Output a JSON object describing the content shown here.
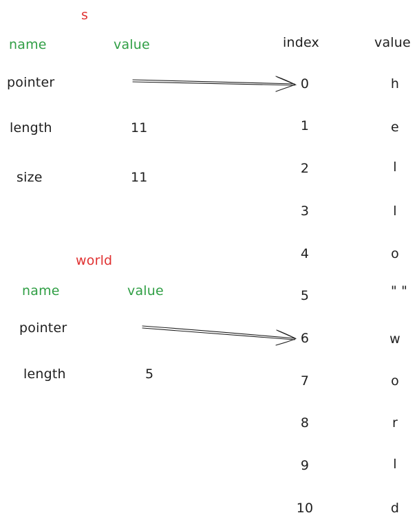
{
  "labels": {
    "struct_s": "s",
    "struct_world": "world",
    "name_header": "name",
    "value_header": "value",
    "index_header": "index",
    "memory_value_header": "value"
  },
  "s_fields": [
    {
      "name": "pointer",
      "value": ""
    },
    {
      "name": "length",
      "value": "11"
    },
    {
      "name": "size",
      "value": "11"
    }
  ],
  "world_fields": [
    {
      "name": "pointer",
      "value": ""
    },
    {
      "name": "length",
      "value": "5"
    }
  ],
  "memory": [
    {
      "index": "0",
      "value": "h"
    },
    {
      "index": "1",
      "value": "e"
    },
    {
      "index": "2",
      "value": "l"
    },
    {
      "index": "3",
      "value": "l"
    },
    {
      "index": "4",
      "value": "o"
    },
    {
      "index": "5",
      "value": "\" \""
    },
    {
      "index": "6",
      "value": "w"
    },
    {
      "index": "7",
      "value": "o"
    },
    {
      "index": "8",
      "value": "r"
    },
    {
      "index": "9",
      "value": "l"
    },
    {
      "index": "10",
      "value": "d"
    }
  ],
  "colors": {
    "title": "#e03131",
    "header": "#2f9e44",
    "text": "#1e1e1e"
  }
}
